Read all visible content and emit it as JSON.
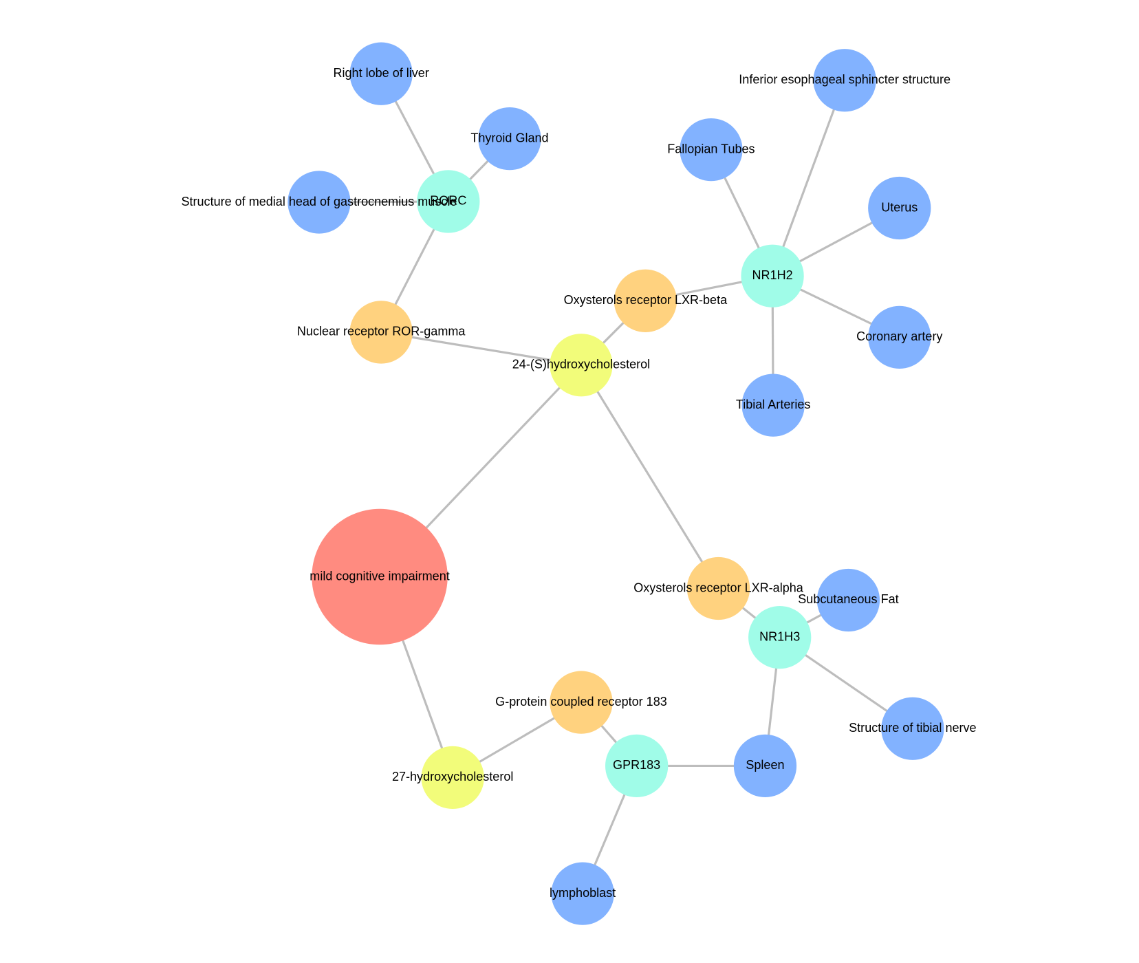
{
  "colors": {
    "disease": "#ff8b80",
    "compound": "#f2fc7a",
    "protein": "#ffd27f",
    "gene": "#a0fce8",
    "tissue": "#82b2ff",
    "edge": "#bdbdbd"
  },
  "nodes": [
    {
      "id": "mci",
      "label": "mild cognitive impairment",
      "type": "disease"
    },
    {
      "id": "oh24",
      "label": "24-(S)hydroxycholesterol",
      "type": "compound"
    },
    {
      "id": "oh27",
      "label": "27-hydroxycholesterol",
      "type": "compound"
    },
    {
      "id": "rorg",
      "label": "Nuclear receptor ROR-gamma",
      "type": "protein"
    },
    {
      "id": "lxrb",
      "label": "Oxysterols receptor LXR-beta",
      "type": "protein"
    },
    {
      "id": "lxra",
      "label": "Oxysterols receptor LXR-alpha",
      "type": "protein"
    },
    {
      "id": "gpr183p",
      "label": "G-protein coupled receptor 183",
      "type": "protein"
    },
    {
      "id": "rorc",
      "label": "RORC",
      "type": "gene"
    },
    {
      "id": "nr1h2",
      "label": "NR1H2",
      "type": "gene"
    },
    {
      "id": "nr1h3",
      "label": "NR1H3",
      "type": "gene"
    },
    {
      "id": "gpr183g",
      "label": "GPR183",
      "type": "gene"
    },
    {
      "id": "liver",
      "label": "Right lobe of liver",
      "type": "tissue"
    },
    {
      "id": "thyroid",
      "label": "Thyroid Gland",
      "type": "tissue"
    },
    {
      "id": "gastro",
      "label": "Structure of medial head of gastrocnemius muscle",
      "type": "tissue"
    },
    {
      "id": "esoph",
      "label": "Inferior esophageal sphincter structure",
      "type": "tissue"
    },
    {
      "id": "fallopian",
      "label": "Fallopian Tubes",
      "type": "tissue"
    },
    {
      "id": "uterus",
      "label": "Uterus",
      "type": "tissue"
    },
    {
      "id": "coronary",
      "label": "Coronary artery",
      "type": "tissue"
    },
    {
      "id": "tibart",
      "label": "Tibial Arteries",
      "type": "tissue"
    },
    {
      "id": "subq",
      "label": "Subcutaneous Fat",
      "type": "tissue"
    },
    {
      "id": "tibnerve",
      "label": "Structure of tibial nerve",
      "type": "tissue"
    },
    {
      "id": "spleen",
      "label": "Spleen",
      "type": "tissue"
    },
    {
      "id": "lympho",
      "label": "lymphoblast",
      "type": "tissue"
    }
  ],
  "edges": [
    [
      "mci",
      "oh24"
    ],
    [
      "mci",
      "oh27"
    ],
    [
      "oh24",
      "rorg"
    ],
    [
      "oh24",
      "lxrb"
    ],
    [
      "oh24",
      "lxra"
    ],
    [
      "rorg",
      "rorc"
    ],
    [
      "rorc",
      "liver"
    ],
    [
      "rorc",
      "thyroid"
    ],
    [
      "rorc",
      "gastro"
    ],
    [
      "lxrb",
      "nr1h2"
    ],
    [
      "nr1h2",
      "fallopian"
    ],
    [
      "nr1h2",
      "esoph"
    ],
    [
      "nr1h2",
      "uterus"
    ],
    [
      "nr1h2",
      "coronary"
    ],
    [
      "nr1h2",
      "tibart"
    ],
    [
      "lxra",
      "nr1h3"
    ],
    [
      "nr1h3",
      "subq"
    ],
    [
      "nr1h3",
      "tibnerve"
    ],
    [
      "nr1h3",
      "spleen"
    ],
    [
      "oh27",
      "gpr183p"
    ],
    [
      "gpr183p",
      "gpr183g"
    ],
    [
      "gpr183g",
      "spleen"
    ],
    [
      "gpr183g",
      "lympho"
    ]
  ]
}
